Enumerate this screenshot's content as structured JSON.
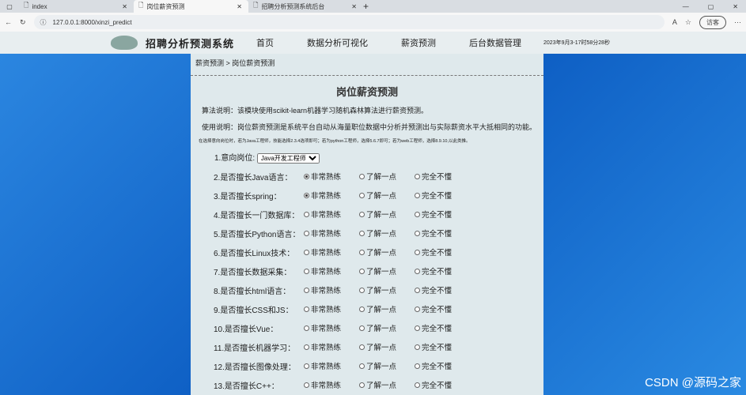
{
  "tabs": [
    {
      "title": "index"
    },
    {
      "title": "岗位薪资预测"
    },
    {
      "title": "招聘分析预测系统后台"
    }
  ],
  "address": {
    "url": "127.0.0.1:8000/xinzi_predict",
    "guest": "访客"
  },
  "nav": {
    "brand": "招聘分析预测系统",
    "items": [
      "首页",
      "数据分析可视化",
      "薪资预测",
      "后台数据管理"
    ],
    "time": "2023年9月3-17时58分28秒"
  },
  "breadcrumb": "薪资预测 > 岗位薪资预测",
  "title": "岗位薪资预测",
  "algo": "算法说明：该模块使用scikit-learn机器学习随机森林算法进行薪资预测。",
  "usage": "使用说明：岗位薪资预测是系统平台自动从海量职位数据中分析并预测出与实际薪资水平大抵相同的功能。",
  "hint": "在选择意向岗位时，若为Java工程师，技能选择2.3.4选项即可；若为python工程师，选择5.6.7即可；若为web工程师，选择8.9.10,以此类推。",
  "position": {
    "label": "1.意向岗位:",
    "value": "Java开发工程师"
  },
  "options": [
    "非常熟练",
    "了解一点",
    "完全不懂"
  ],
  "questions": [
    {
      "label": "2.是否擅长Java语言：",
      "selected": 0
    },
    {
      "label": "3.是否擅长spring：",
      "selected": 0
    },
    {
      "label": "4.是否擅长一门数据库：",
      "selected": -1
    },
    {
      "label": "5.是否擅长Python语言：",
      "selected": -1
    },
    {
      "label": "6.是否擅长Linux技术：",
      "selected": -1
    },
    {
      "label": "7.是否擅长数据采集：",
      "selected": -1
    },
    {
      "label": "8.是否擅长html语言：",
      "selected": -1
    },
    {
      "label": "9.是否擅长CSS和JS：",
      "selected": -1
    },
    {
      "label": "10.是否擅长Vue：",
      "selected": -1
    },
    {
      "label": "11.是否擅长机器学习：",
      "selected": -1
    },
    {
      "label": "12.是否擅长图像处理：",
      "selected": -1
    },
    {
      "label": "13.是否擅长C++：",
      "selected": -1
    }
  ],
  "watermark": "CSDN @源码之家"
}
